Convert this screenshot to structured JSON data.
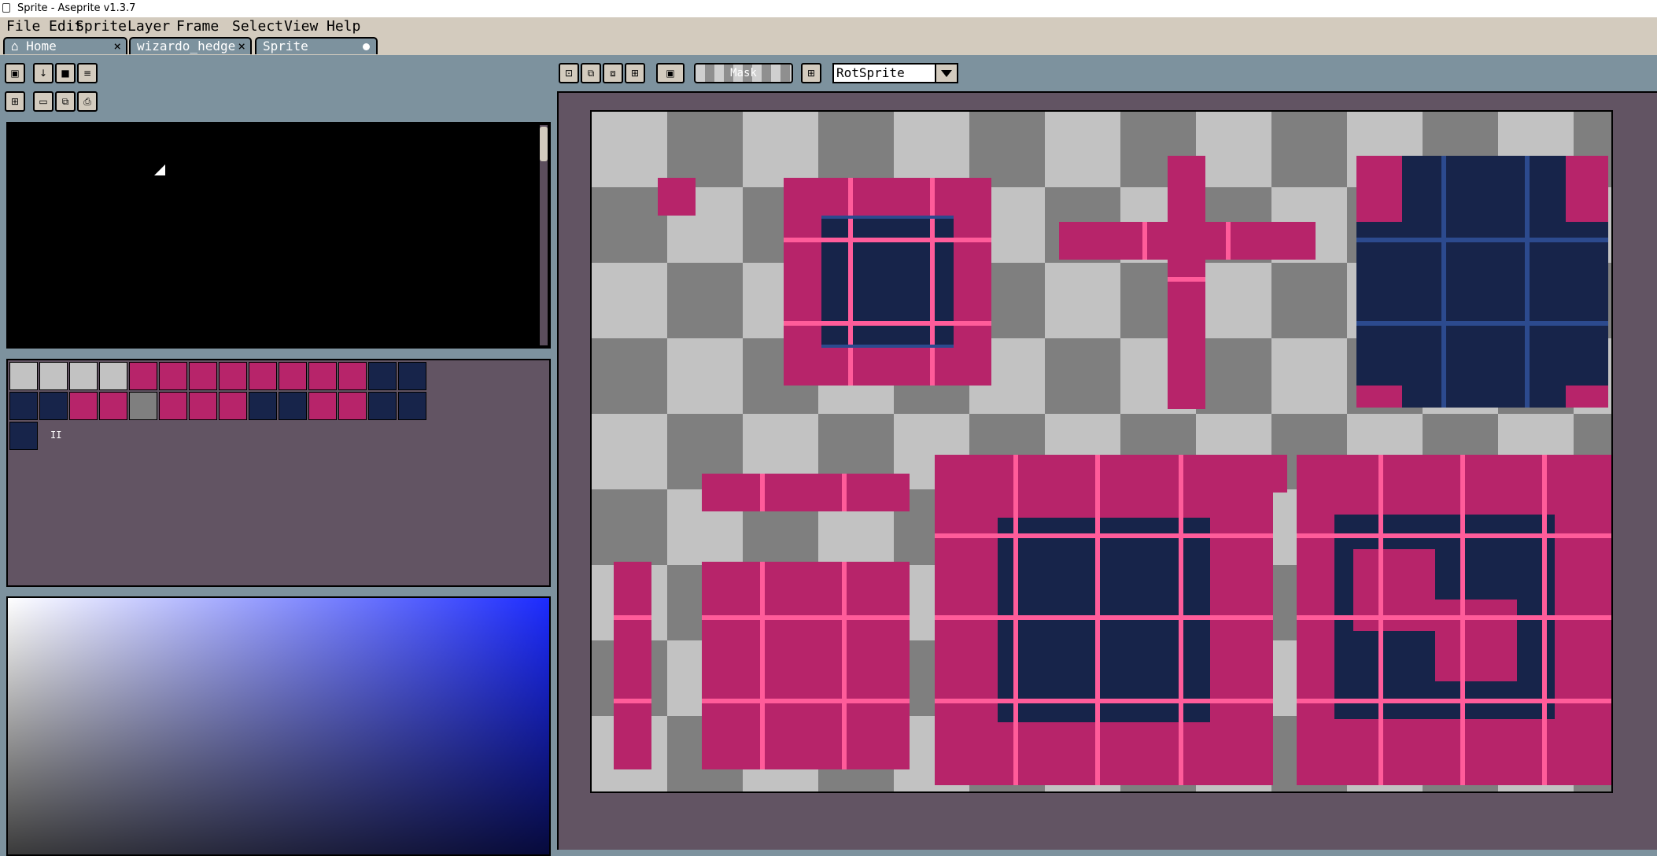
{
  "window": {
    "title": "Sprite - Aseprite v1.3.7"
  },
  "menu": [
    "File",
    "Edit",
    "Sprite",
    "Layer",
    "Frame",
    "Select",
    "View",
    "Help"
  ],
  "tabs": [
    {
      "label": "Home",
      "icon": "home-icon"
    },
    {
      "label": "wizardo_hedge"
    },
    {
      "label": "Sprite",
      "modified": true
    }
  ],
  "tileset": {
    "label": "II"
  },
  "toolbar": {
    "mask_label": "Mask",
    "rotation_algorithm": "RotSprite"
  },
  "colors": {
    "pink": "#b7246a",
    "navy": "#17244a",
    "light_pink": "#ff5c9a",
    "blue_line": "#2c4a8e",
    "bg": "#625463"
  }
}
